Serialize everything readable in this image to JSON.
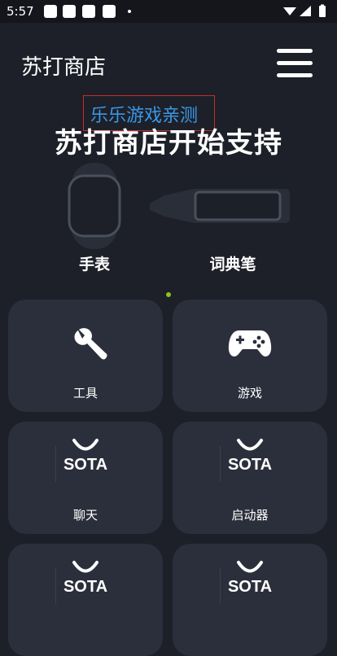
{
  "status_bar": {
    "time": "5:57"
  },
  "header": {
    "title": "苏打商店"
  },
  "overlay": {
    "label": "乐乐游戏亲测"
  },
  "banner": {
    "headline": "苏打商店开始支持",
    "devices": [
      {
        "label": "手表"
      },
      {
        "label": "词典笔"
      }
    ]
  },
  "categories": [
    {
      "label": "工具",
      "icon": "wrench-icon"
    },
    {
      "label": "游戏",
      "icon": "gamepad-icon"
    },
    {
      "label": "聊天",
      "logo_text": "SOTA"
    },
    {
      "label": "启动器",
      "logo_text": "SOTA"
    },
    {
      "label": "",
      "logo_text": "SOTA"
    },
    {
      "label": "",
      "logo_text": "SOTA"
    }
  ],
  "colors": {
    "background": "#1d2029",
    "card": "#2b2f3b",
    "accent_dot": "#8fc21f",
    "overlay_text": "#3a97e6",
    "overlay_border": "#c62c2c"
  }
}
